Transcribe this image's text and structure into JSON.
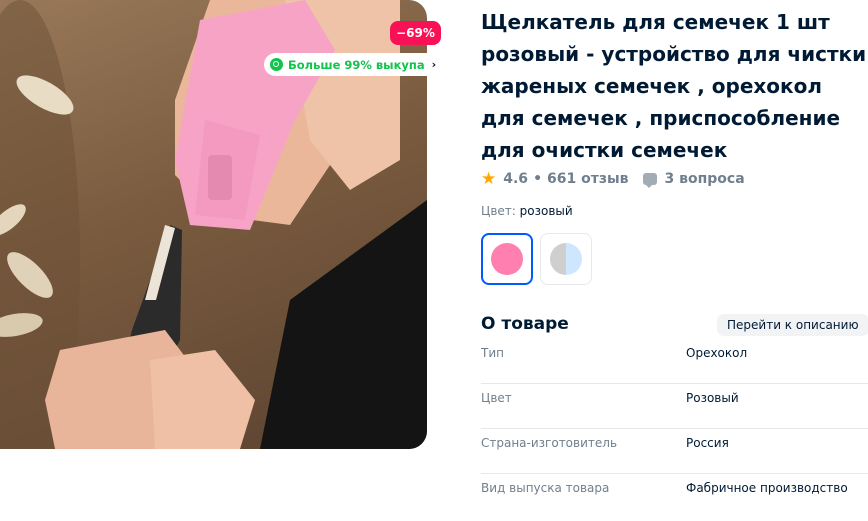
{
  "gallery": {
    "discount_badge": "−69%",
    "promo_text": "Больше 99% выкупа",
    "promo_chevron": "›",
    "zoom_icon": "search-icon"
  },
  "product": {
    "title": "Щелкатель для семечек 1 шт розовый - устройство для чистки жареных семечек , орехокол для семечек , приспособление для очистки семечек",
    "rating": "4.6",
    "separator": "•",
    "reviews": "661 отзыв",
    "questions": "3 вопроса",
    "color_label": "Цвет:",
    "color_value": "розовый"
  },
  "swatches": {
    "selected_color": "#ff7fb0",
    "alt_colors": [
      "#cfcfcf",
      "#cfe6ff"
    ]
  },
  "about": {
    "title": "О товаре",
    "goto_label": "Перейти к описанию",
    "specs": [
      {
        "key": "Тип",
        "value": "Орехокол"
      },
      {
        "key": "Цвет",
        "value": "Розовый"
      },
      {
        "key": "Страна-изготовитель",
        "value": "Россия"
      },
      {
        "key": "Вид выпуска товара",
        "value": "Фабричное производство"
      }
    ]
  },
  "colors": {
    "accent": "#005bff",
    "discount": "#f91155",
    "promo": "#10c44c",
    "star": "#ffa800"
  }
}
